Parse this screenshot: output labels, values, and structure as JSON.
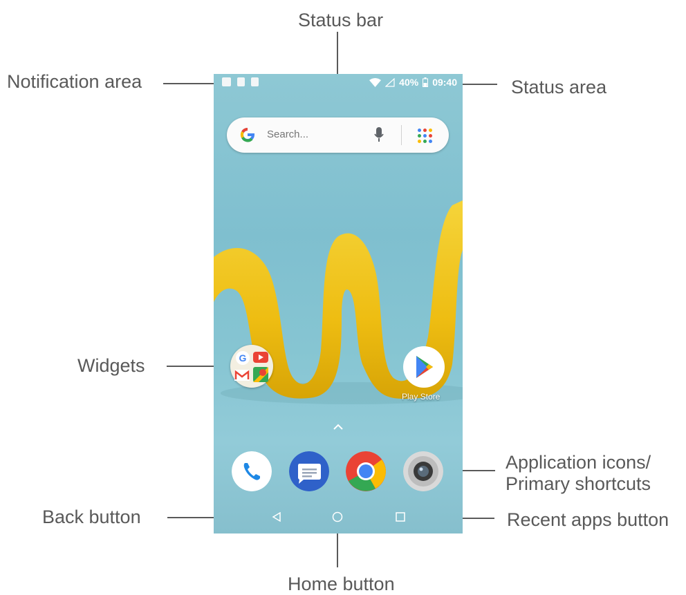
{
  "callouts": {
    "status_bar": "Status bar",
    "notification_area": "Notification area",
    "status_area": "Status area",
    "widgets": "Widgets",
    "app_icons_line1": "Application icons/",
    "app_icons_line2": "Primary shortcuts",
    "back_button": "Back button",
    "recent_apps_button": "Recent apps button",
    "home_button": "Home button"
  },
  "phone": {
    "status_bar": {
      "notification_icons": [
        "image-icon",
        "sim-card-icon",
        "sd-card-icon"
      ],
      "battery_percent": "40%",
      "time": "09:40"
    },
    "search": {
      "placeholder": "Search..."
    },
    "play_store_label": "Play Store",
    "dock": [
      "phone-icon",
      "messages-icon",
      "chrome-icon",
      "camera-icon"
    ],
    "colors": {
      "wallpaper": "#86c5d2",
      "google_blue": "#4285f4",
      "google_red": "#ea4335",
      "google_yellow": "#fbbc05",
      "google_green": "#34a853"
    }
  }
}
